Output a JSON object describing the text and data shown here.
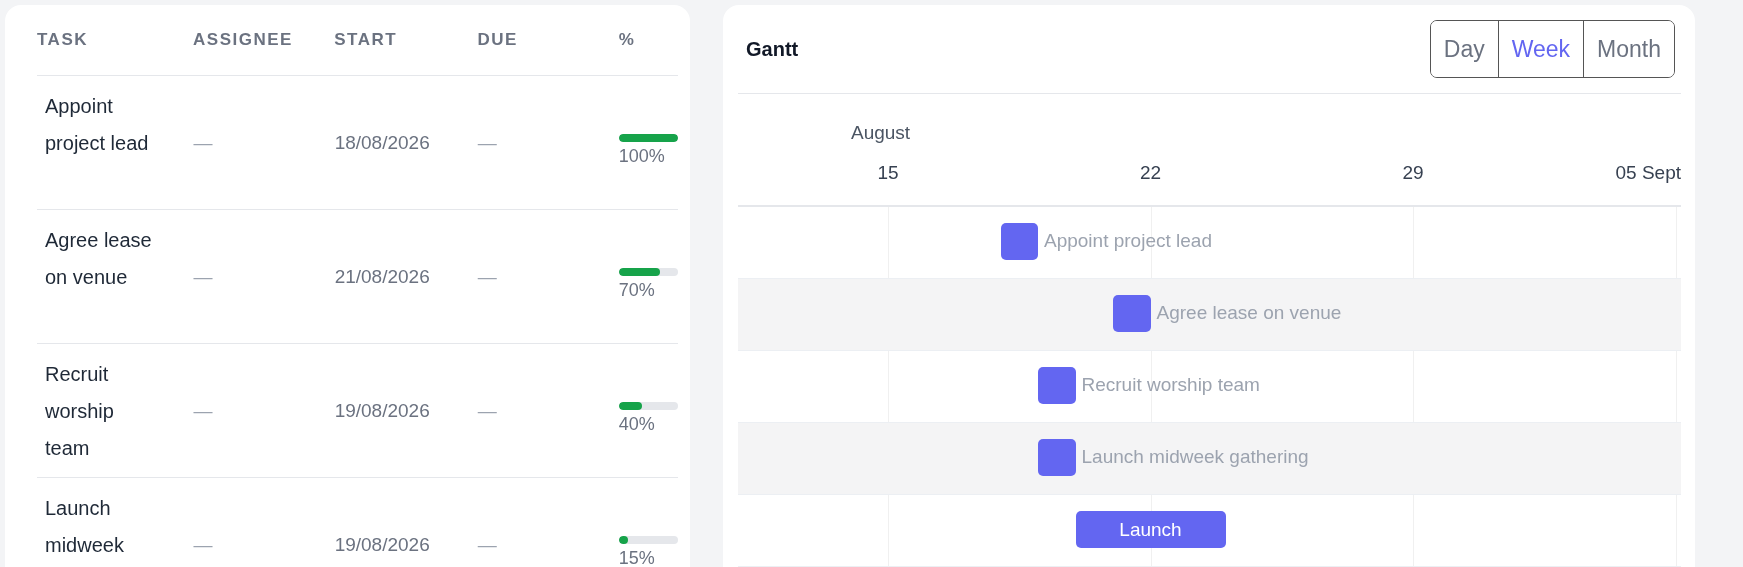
{
  "table": {
    "columns": [
      "TASK",
      "ASSIGNEE",
      "START",
      "DUE",
      "%"
    ],
    "rows": [
      {
        "task": "Appoint project lead",
        "assignee": "—",
        "start": "18/08/2026",
        "due": "—",
        "level": 1,
        "percent": "100%"
      },
      {
        "task": "Agree lease on venue",
        "assignee": "—",
        "start": "21/08/2026",
        "due": "—",
        "level": 0.7,
        "percent": "70%"
      },
      {
        "task": "Recruit worship team",
        "assignee": "—",
        "start": "19/08/2026",
        "due": "—",
        "level": 0.4,
        "percent": "40%"
      },
      {
        "task": "Launch midweek",
        "assignee": "—",
        "start": "19/08/2026",
        "due": "—",
        "level": 0.15,
        "percent": "15%"
      }
    ]
  },
  "gantt": {
    "title": "Gantt",
    "views": [
      {
        "label": "Day",
        "selected": false
      },
      {
        "label": "Week",
        "selected": true
      },
      {
        "label": "Month",
        "selected": false
      }
    ],
    "month": "August",
    "ticks": [
      "15",
      "22",
      "29",
      "05 Sept"
    ],
    "bars": [
      {
        "kind": "task",
        "label": "Appoint project lead"
      },
      {
        "kind": "task",
        "label": "Agree lease on venue"
      },
      {
        "kind": "task",
        "label": "Recruit worship team"
      },
      {
        "kind": "task",
        "label": "Launch midweek gathering"
      },
      {
        "kind": "labelled",
        "label": "Launch"
      }
    ]
  }
}
